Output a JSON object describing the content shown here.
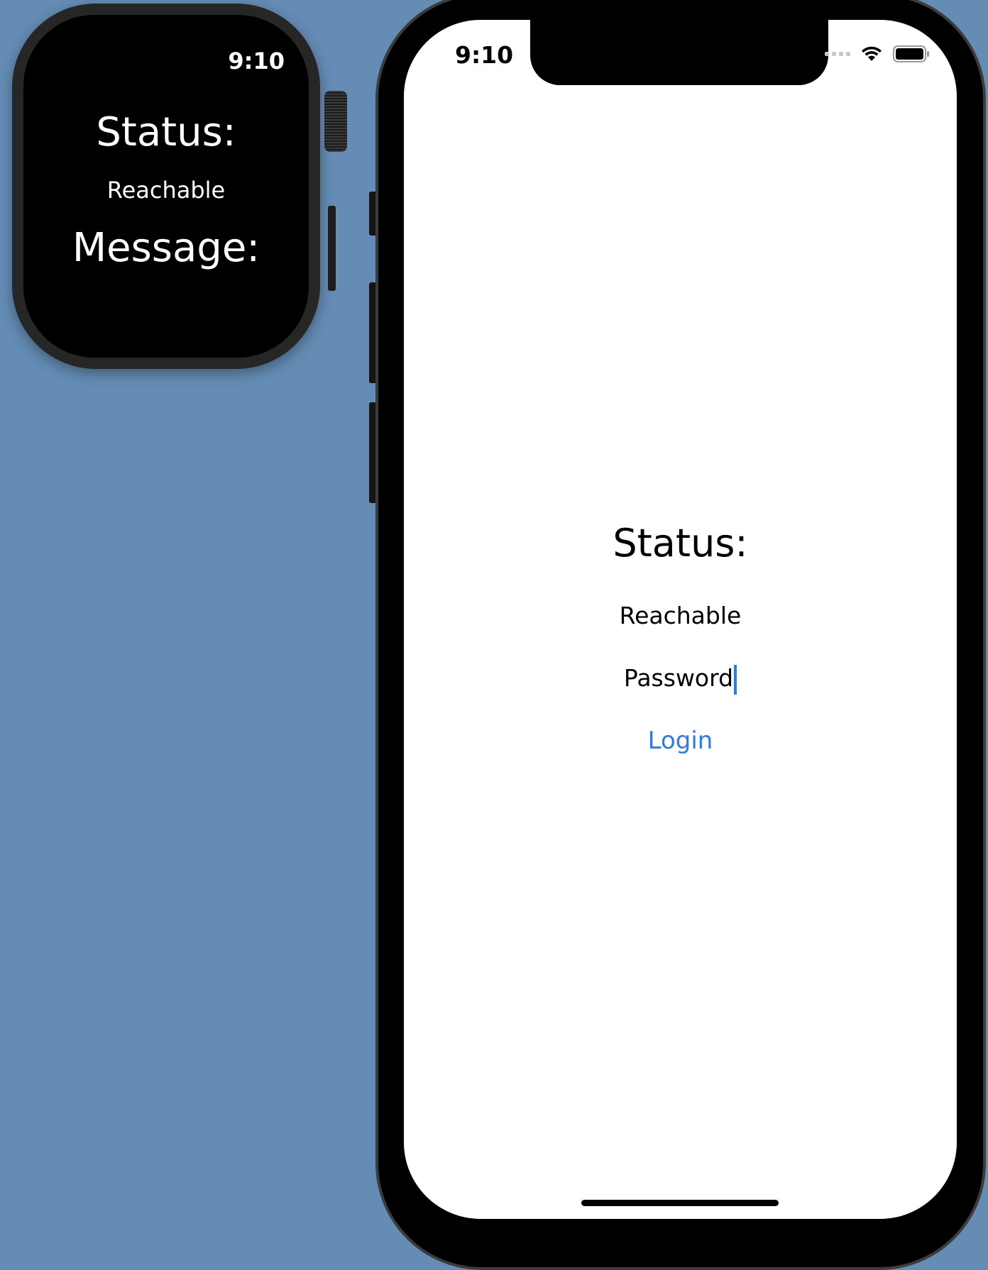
{
  "watch": {
    "time": "9:10",
    "status_title": "Status:",
    "status_value": "Reachable",
    "message_title": "Message:"
  },
  "phone": {
    "time": "9:10",
    "status_title": "Status:",
    "status_value": "Reachable",
    "password_value": "Password",
    "login_label": "Login",
    "accent_color": "#2f7ae5",
    "icons": [
      "cellular-signal-icon",
      "wifi-icon",
      "battery-icon"
    ]
  },
  "background_color": "#648cb4"
}
